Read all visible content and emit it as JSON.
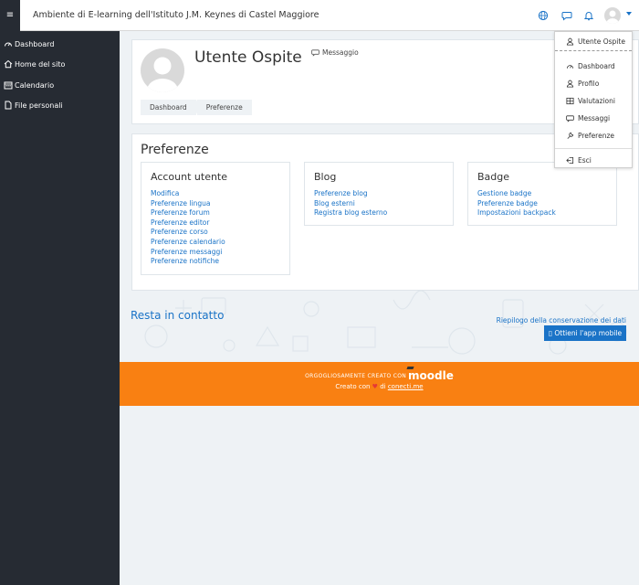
{
  "navbar": {
    "menu_glyph": "≡",
    "site_title": "Ambiente di E-learning dell'Istituto J.M. Keynes di Castel Maggiore",
    "icons": [
      "globe-icon",
      "chat-icon",
      "bell-icon"
    ],
    "accent": "#1a73c7"
  },
  "sidebar": {
    "background": "#262b33",
    "items": [
      {
        "label": "Dashboard",
        "icon": "dashboard-icon"
      },
      {
        "label": "Home del sito",
        "icon": "home-icon"
      },
      {
        "label": "Calendario",
        "icon": "calendar-icon"
      },
      {
        "label": "File personali",
        "icon": "file-icon"
      }
    ]
  },
  "profile": {
    "name": "Utente Ospite",
    "message_label": "Messaggio"
  },
  "breadcrumb": [
    "Dashboard",
    "Preferenze"
  ],
  "main": {
    "title": "Preferenze",
    "sections": [
      {
        "title": "Account utente",
        "links": [
          "Modifica",
          "Preferenze lingua",
          "Preferenze forum",
          "Preferenze editor",
          "Preferenze corso",
          "Preferenze calendario",
          "Preferenze messaggi",
          "Preferenze notifiche"
        ]
      },
      {
        "title": "Blog",
        "links": [
          "Preferenze blog",
          "Blog esterni",
          "Registra blog esterno"
        ]
      },
      {
        "title": "Badge",
        "links": [
          "Gestione badge",
          "Preferenze badge",
          "Impostazioni backpack"
        ]
      }
    ]
  },
  "contact": {
    "title": "Resta in contatto",
    "retention_link": "Riepilogo della conservazione dei dati",
    "app_button": "Ottieni l'app mobile"
  },
  "footer": {
    "background": "#f98012",
    "made_with": "ORGOGLIOSAMENTE CREATO CON",
    "brand": "moodle",
    "created_prefix": "Creato con",
    "created_mid": "di",
    "created_link": "conecti.me"
  },
  "user_menu": {
    "header": "Utente Ospite",
    "items": [
      {
        "label": "Dashboard",
        "icon": "dashboard-icon"
      },
      {
        "label": "Profilo",
        "icon": "user-icon"
      },
      {
        "label": "Valutazioni",
        "icon": "table-icon"
      },
      {
        "label": "Messaggi",
        "icon": "chat-icon"
      },
      {
        "label": "Preferenze",
        "icon": "wrench-icon"
      }
    ],
    "logout": "Esci"
  }
}
